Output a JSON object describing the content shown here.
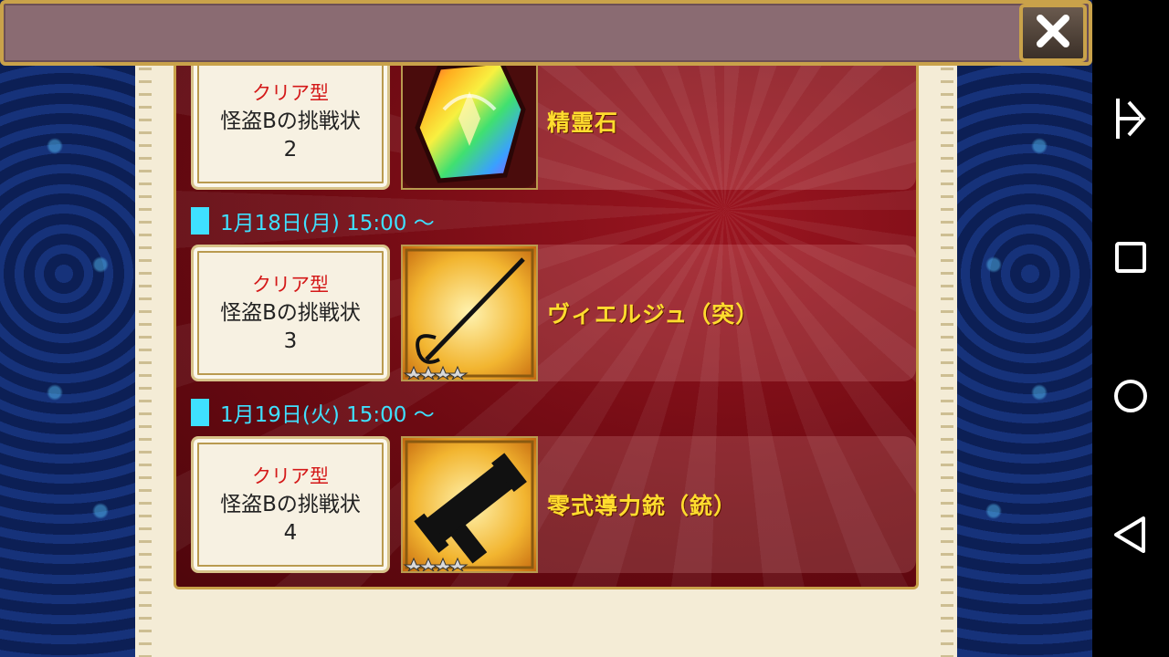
{
  "header": {
    "close_icon": "close-icon"
  },
  "list": {
    "entries": [
      {
        "type": "クリア型",
        "name": "怪盗Bの挑戦状",
        "number": "2",
        "item_name": "精霊石",
        "icon": "rainbow-crystal-icon"
      },
      {
        "date": "1月18日(月) 15:00 〜",
        "type": "クリア型",
        "name": "怪盗Bの挑戦状",
        "number": "3",
        "item_name": "ヴィエルジュ（突）",
        "icon": "rapier-icon",
        "rarity_stars": 4
      },
      {
        "date": "1月19日(火) 15:00 〜",
        "type": "クリア型",
        "name": "怪盗Bの挑戦状",
        "number": "4",
        "item_name": "零式導力銃（銃）",
        "icon": "gun-icon",
        "rarity_stars": 4
      }
    ]
  },
  "system_nav": {
    "buttons": [
      "notification-icon",
      "recents-icon",
      "home-icon",
      "back-icon"
    ]
  },
  "colors": {
    "date_text": "#3fe0ff",
    "item_name": "#ffdc2e",
    "clear_type": "#d41818",
    "panel_red": "#7a0d15",
    "gold_border": "#c9a24a"
  }
}
